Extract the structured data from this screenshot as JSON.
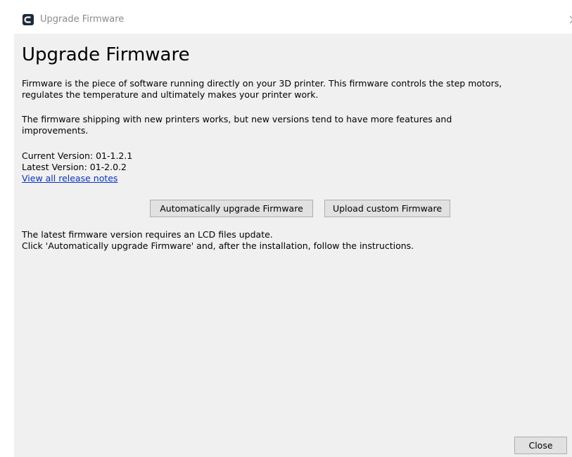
{
  "window": {
    "title": "Upgrade Firmware",
    "app_icon": "cura-logo-icon",
    "close_icon": "close-icon"
  },
  "heading": "Upgrade Firmware",
  "description": {
    "line1": "Firmware is the piece of software running directly on your 3D printer. This firmware controls the step motors,",
    "line2": "regulates the temperature and ultimately makes your printer work.",
    "line3": "The firmware shipping with new printers works, but new versions tend to have more features and",
    "line4": "improvements."
  },
  "versions": {
    "current": "Current Version: 01-1.2.1",
    "latest": "Latest Version: 01-2.0.2",
    "release_notes_link": "View all release notes"
  },
  "buttons": {
    "auto_upgrade": "Automatically upgrade Firmware",
    "upload_custom": "Upload custom Firmware",
    "close": "Close"
  },
  "notice": {
    "line1": "The latest firmware version requires an LCD files update.",
    "line2": "Click 'Automatically upgrade Firmware' and, after the installation, follow the instructions."
  },
  "colors": {
    "link": "#0b33cc",
    "dialog_background": "#f0f0f0",
    "button_background": "#e1e1e1"
  }
}
